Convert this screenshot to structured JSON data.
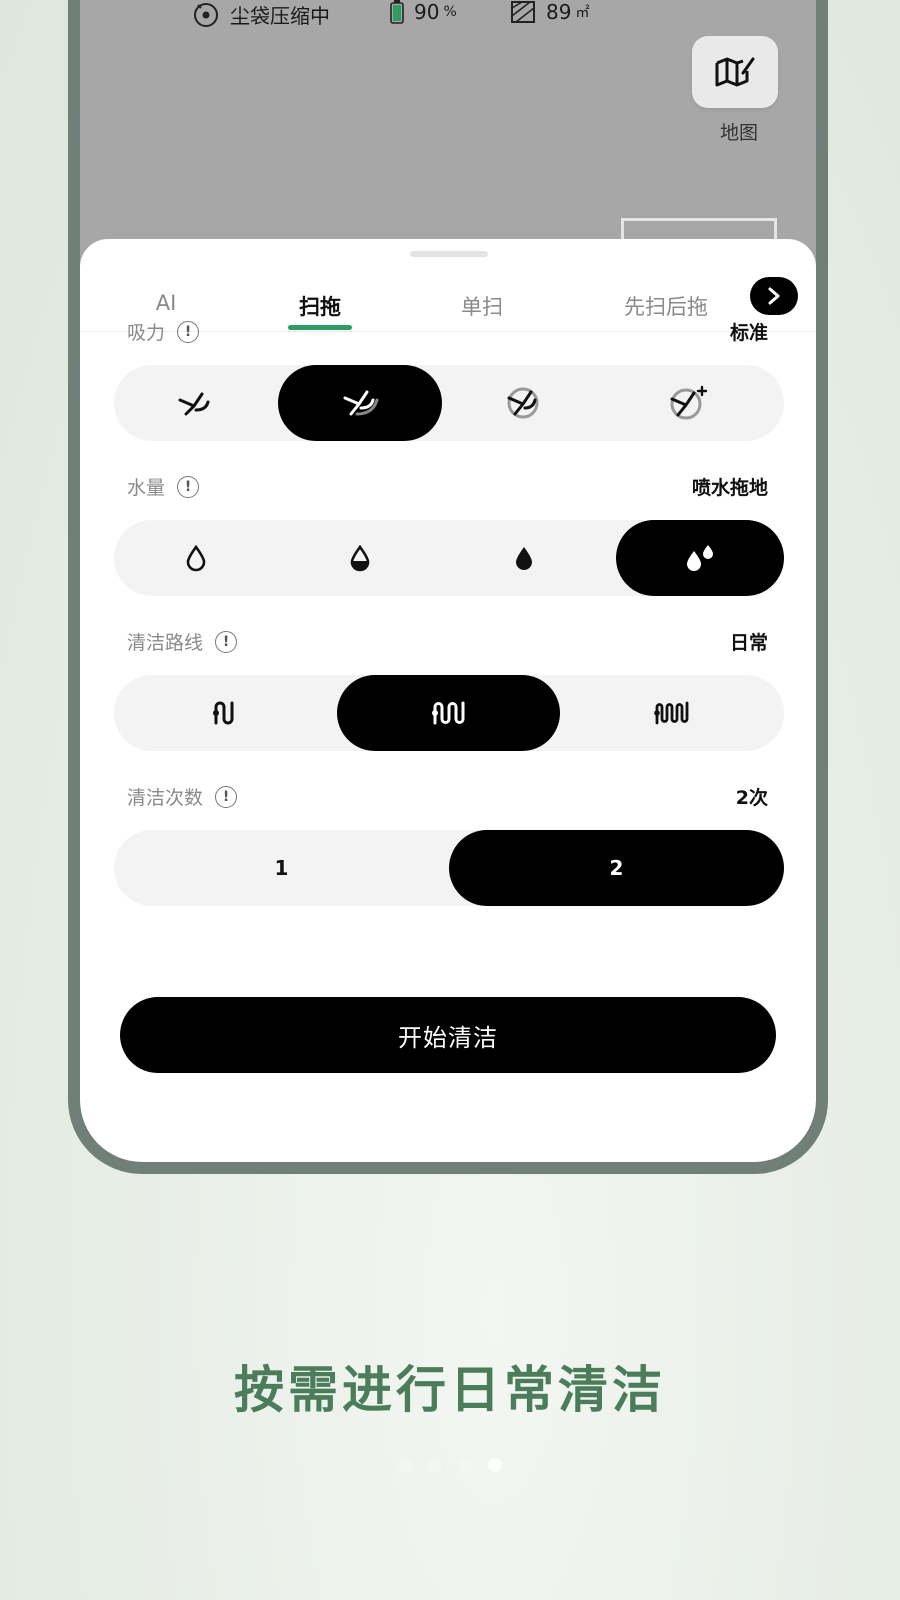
{
  "status": {
    "dustbag": "尘袋压缩中",
    "battery": "90",
    "battery_unit": "%",
    "area": "89",
    "area_unit": "㎡"
  },
  "map_button": {
    "label": "地图",
    "icon": "map-edit-icon"
  },
  "tabs": [
    "AI",
    "扫拖",
    "单扫",
    "先扫后拖"
  ],
  "active_tab": "扫拖",
  "suction": {
    "label": "吸力",
    "value": "标准",
    "options": [
      "quiet-fan-icon",
      "standard-fan-icon",
      "strong-fan-icon",
      "max-plus-fan-icon"
    ],
    "selected_index": 1
  },
  "water": {
    "label": "水量",
    "value": "喷水拖地",
    "options": [
      "drop-low-icon",
      "drop-medium-icon",
      "drop-high-icon",
      "spray-drops-icon"
    ],
    "selected_index": 3
  },
  "route": {
    "label": "清洁路线",
    "value": "日常",
    "options": [
      "route-fast-icon",
      "route-daily-icon",
      "route-deep-icon"
    ],
    "selected_index": 1
  },
  "passes": {
    "label": "清洁次数",
    "value": "2次",
    "options": [
      "1",
      "2"
    ],
    "selected_index": 1
  },
  "start_button": "开始清洁",
  "headline": "按需进行日常清洁",
  "pager": {
    "total": 4,
    "current": 4
  },
  "colors": {
    "accent": "#2f9c63",
    "headline": "#4b7d5a",
    "frame": "#707f78"
  }
}
